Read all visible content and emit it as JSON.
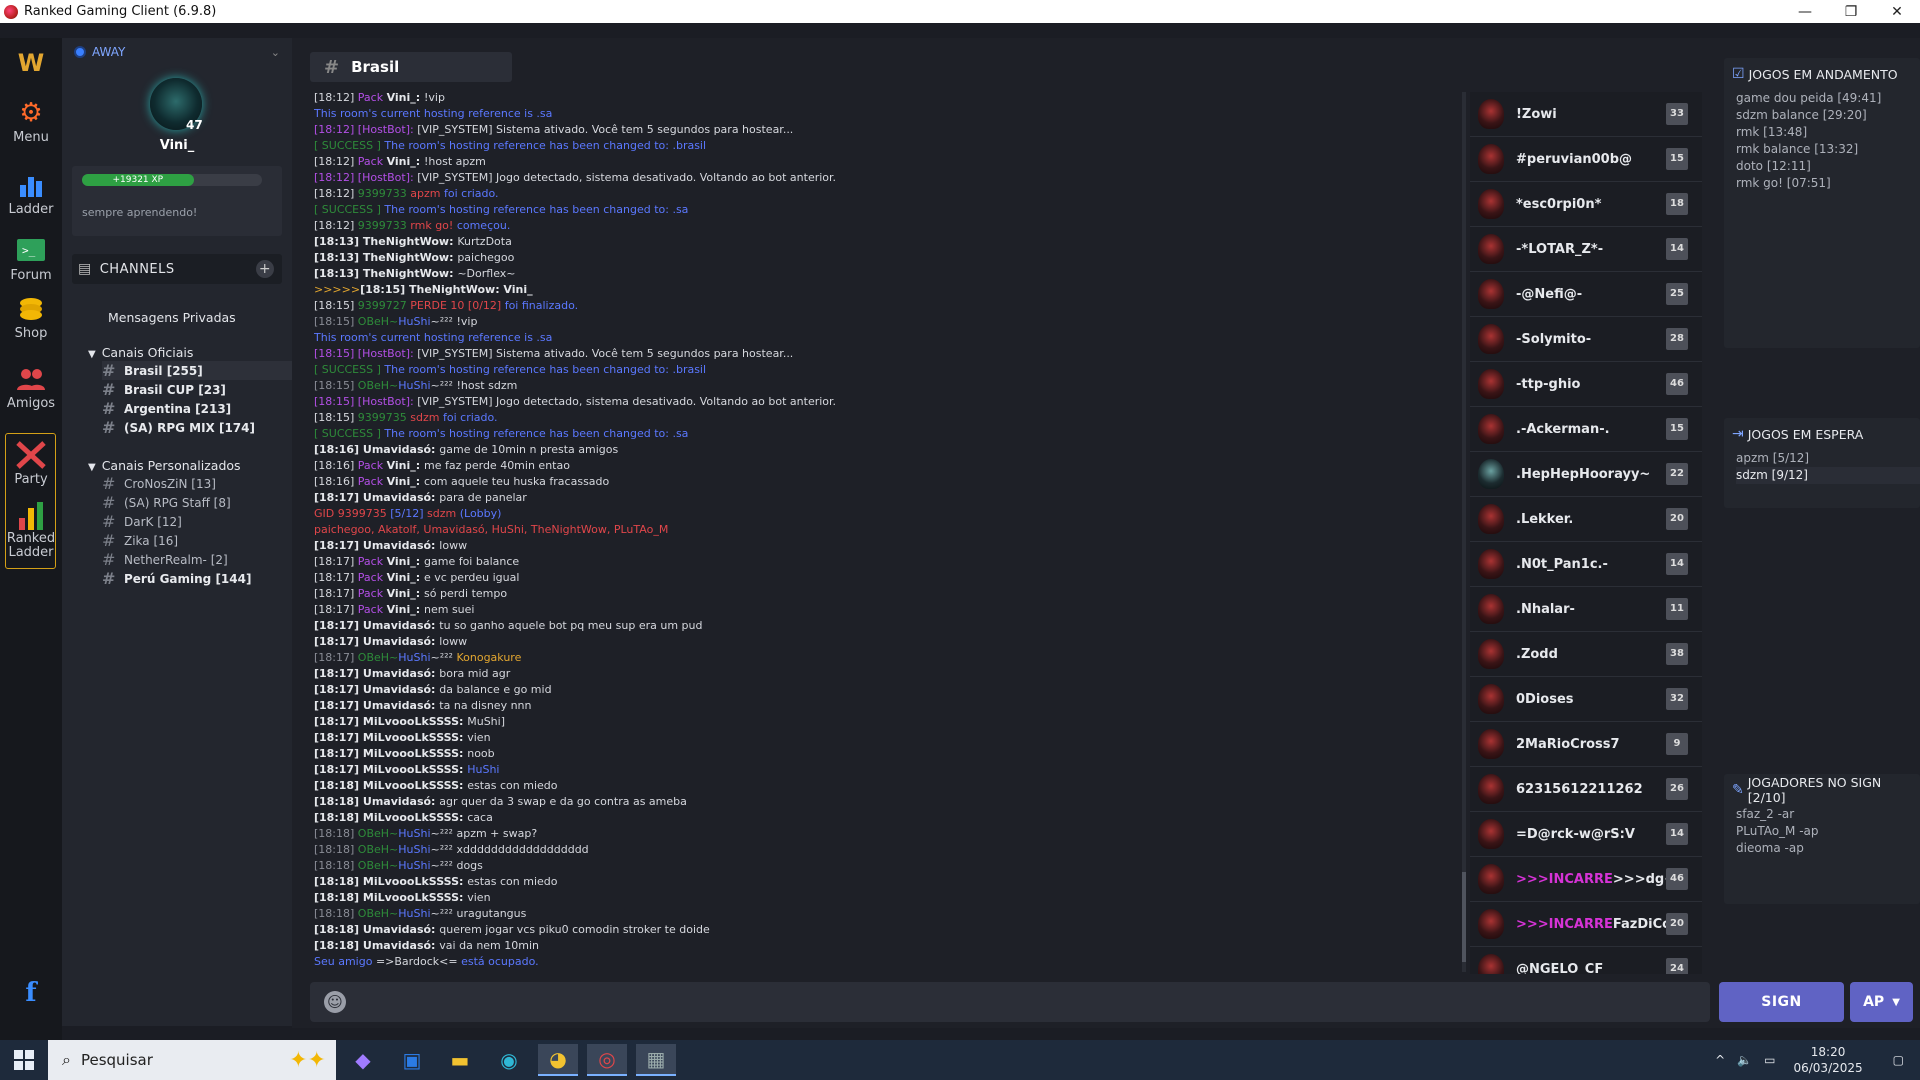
{
  "window": {
    "title": "Ranked Gaming Client (6.9.8)",
    "minimize": "—",
    "maximize": "❐",
    "close": "✕"
  },
  "rail": {
    "menu": "Menu",
    "ladder": "Ladder",
    "forum": "Forum",
    "shop": "Shop",
    "amigos": "Amigos",
    "party": "Party",
    "ranked_ladder_1": "Ranked",
    "ranked_ladder_2": "Ladder",
    "facebook": "f"
  },
  "profile": {
    "status": "AWAY",
    "level": "47",
    "name": "Vini_",
    "xp": "+19321 XP",
    "xp_progress": 0.62,
    "motto": "sempre aprendendo!"
  },
  "channels": {
    "title": "CHANNELS",
    "dm": "Mensagens Privadas",
    "official_title": "Canais Oficiais",
    "official": [
      "Brasil [255]",
      "Brasil CUP [23]",
      "Argentina [213]",
      "(SA) RPG MIX [174]"
    ],
    "custom_title": "Canais Personalizados",
    "custom": [
      "CroNosZiN [13]",
      "(SA) RPG Staff [8]",
      "DarK [12]",
      "Zika [16]",
      "NetherRealm- [2]",
      "Perú Gaming [144]"
    ]
  },
  "chat": {
    "channel": "Brasil",
    "lines": [
      [
        [
          "t",
          "[18:12] "
        ],
        [
          "purp",
          "Pack "
        ],
        [
          "bold",
          "Vini_: "
        ],
        [
          "t",
          "!vip"
        ]
      ],
      [
        [
          "sys",
          "This room's current hosting reference is .sa"
        ]
      ],
      [
        [
          "purp",
          "[18:12] [HostBot]: "
        ],
        [
          "t",
          "[VIP_SYSTEM] Sistema ativado. Você tem 5 segundos para hostear..."
        ]
      ],
      [
        [
          "grn",
          "[ SUCCESS ] "
        ],
        [
          "sys",
          "The room's hosting reference has been changed to: .brasil"
        ]
      ],
      [
        [
          "t",
          "[18:12] "
        ],
        [
          "purp",
          "Pack "
        ],
        [
          "bold",
          "Vini_: "
        ],
        [
          "t",
          "!host apzm"
        ]
      ],
      [
        [
          "purp",
          "[18:12] [HostBot]: "
        ],
        [
          "t",
          "[VIP_SYSTEM] Jogo detectado, sistema desativado. Voltando ao bot anterior."
        ]
      ],
      [
        [
          "t",
          "[18:12] "
        ],
        [
          "grn",
          "9399733 "
        ],
        [
          "red",
          "apzm "
        ],
        [
          "sys",
          "foi criado."
        ]
      ],
      [
        [
          "grn",
          "[ SUCCESS ] "
        ],
        [
          "sys",
          "The room's hosting reference has been changed to: .sa"
        ]
      ],
      [
        [
          "t",
          "[18:12] "
        ],
        [
          "grn",
          "9399733 "
        ],
        [
          "red",
          "rmk go! "
        ],
        [
          "sys",
          "começou."
        ]
      ],
      [
        [
          "bold",
          "[18:13] TheNightWow: "
        ],
        [
          "t",
          "KurtzDota"
        ]
      ],
      [
        [
          "bold",
          "[18:13] TheNightWow: "
        ],
        [
          "t",
          "paichegoo"
        ]
      ],
      [
        [
          "bold",
          "[18:13] TheNightWow: "
        ],
        [
          "t",
          "~Dorflex~"
        ]
      ],
      [
        [
          "gold",
          ">>>>>"
        ],
        [
          "bold",
          "[18:15] TheNightWow: Vini_"
        ]
      ],
      [
        [
          "t",
          "[18:15] "
        ],
        [
          "grn",
          "9399727 "
        ],
        [
          "red",
          "PERDE 10 [0/12] "
        ],
        [
          "sys",
          "foi finalizado."
        ]
      ],
      [
        [
          "tg",
          "[18:15] "
        ],
        [
          "grn",
          "OBeH~"
        ],
        [
          "sys",
          "HuShi"
        ],
        [
          "t",
          "~²²² "
        ],
        [
          "t",
          "!vip"
        ]
      ],
      [
        [
          "sys",
          "This room's current hosting reference is .sa"
        ]
      ],
      [
        [
          "purp",
          "[18:15] [HostBot]: "
        ],
        [
          "t",
          "[VIP_SYSTEM] Sistema ativado. Você tem 5 segundos para hostear..."
        ]
      ],
      [
        [
          "grn",
          "[ SUCCESS ] "
        ],
        [
          "sys",
          "The room's hosting reference has been changed to: .brasil"
        ]
      ],
      [
        [
          "tg",
          "[18:15] "
        ],
        [
          "grn",
          "OBeH~"
        ],
        [
          "sys",
          "HuShi"
        ],
        [
          "t",
          "~²²² "
        ],
        [
          "t",
          "!host sdzm"
        ]
      ],
      [
        [
          "purp",
          "[18:15] [HostBot]: "
        ],
        [
          "t",
          "[VIP_SYSTEM] Jogo detectado, sistema desativado. Voltando ao bot anterior."
        ]
      ],
      [
        [
          "t",
          "[18:15] "
        ],
        [
          "grn",
          "9399735 "
        ],
        [
          "red",
          "sdzm "
        ],
        [
          "sys",
          "foi criado."
        ]
      ],
      [
        [
          "grn",
          "[ SUCCESS ] "
        ],
        [
          "sys",
          "The room's hosting reference has been changed to: .sa"
        ]
      ],
      [
        [
          "bold",
          "[18:16] Umavidasó: "
        ],
        [
          "t",
          "game de 10min n presta amigos"
        ]
      ],
      [
        [
          "t",
          "[18:16] "
        ],
        [
          "purp",
          "Pack "
        ],
        [
          "bold",
          "Vini_: "
        ],
        [
          "t",
          "me faz perde 40min entao"
        ]
      ],
      [
        [
          "t",
          "[18:16] "
        ],
        [
          "purp",
          "Pack "
        ],
        [
          "bold",
          "Vini_: "
        ],
        [
          "t",
          "com aquele teu huska fracassado"
        ]
      ],
      [
        [
          "bold",
          "[18:17] Umavidasó: "
        ],
        [
          "t",
          "para de panelar"
        ]
      ],
      [
        [
          "red",
          "GID 9399735 "
        ],
        [
          "sys",
          "[5/12] "
        ],
        [
          "red",
          "sdzm "
        ],
        [
          "sys",
          "(Lobby)"
        ]
      ],
      [
        [
          "red",
          "paichegoo, Akatolf, Umavidasó, HuShi, TheNightWow, PLuTAo_M"
        ]
      ],
      [
        [
          "bold",
          "[18:17] Umavidasó: "
        ],
        [
          "t",
          "loww"
        ]
      ],
      [
        [
          "t",
          "[18:17] "
        ],
        [
          "purp",
          "Pack "
        ],
        [
          "bold",
          "Vini_: "
        ],
        [
          "t",
          "game foi balance"
        ]
      ],
      [
        [
          "t",
          "[18:17] "
        ],
        [
          "purp",
          "Pack "
        ],
        [
          "bold",
          "Vini_: "
        ],
        [
          "t",
          "e vc perdeu igual"
        ]
      ],
      [
        [
          "t",
          "[18:17] "
        ],
        [
          "purp",
          "Pack "
        ],
        [
          "bold",
          "Vini_: "
        ],
        [
          "t",
          "só perdi tempo"
        ]
      ],
      [
        [
          "t",
          "[18:17] "
        ],
        [
          "purp",
          "Pack "
        ],
        [
          "bold",
          "Vini_: "
        ],
        [
          "t",
          "nem suei"
        ]
      ],
      [
        [
          "bold",
          "[18:17] Umavidasó: "
        ],
        [
          "t",
          "tu so ganho aquele bot pq meu sup era um pud"
        ]
      ],
      [
        [
          "bold",
          "[18:17] Umavidasó: "
        ],
        [
          "t",
          "loww"
        ]
      ],
      [
        [
          "tg",
          "[18:17] "
        ],
        [
          "grn",
          "OBeH~"
        ],
        [
          "sys",
          "HuShi"
        ],
        [
          "t",
          "~²²² "
        ],
        [
          "gold",
          "Konogakure"
        ]
      ],
      [
        [
          "bold",
          "[18:17] Umavidasó: "
        ],
        [
          "t",
          "bora mid agr"
        ]
      ],
      [
        [
          "bold",
          "[18:17] Umavidasó: "
        ],
        [
          "t",
          "da balance e go mid"
        ]
      ],
      [
        [
          "bold",
          "[18:17] Umavidasó: "
        ],
        [
          "t",
          "ta na disney nnn"
        ]
      ],
      [
        [
          "bold",
          "[18:17] MiLvoooLkSSSS: "
        ],
        [
          "t",
          "MuShi]"
        ]
      ],
      [
        [
          "bold",
          "[18:17] MiLvoooLkSSSS: "
        ],
        [
          "t",
          "vien"
        ]
      ],
      [
        [
          "bold",
          "[18:17] MiLvoooLkSSSS: "
        ],
        [
          "t",
          "noob"
        ]
      ],
      [
        [
          "bold",
          "[18:17] MiLvoooLkSSSS: "
        ],
        [
          "sys",
          "HuShi"
        ]
      ],
      [
        [
          "bold",
          "[18:18] MiLvoooLkSSSS: "
        ],
        [
          "t",
          "estas con miedo"
        ]
      ],
      [
        [
          "bold",
          "[18:18] Umavidasó: "
        ],
        [
          "t",
          "agr quer da 3 swap e da go contra as ameba"
        ]
      ],
      [
        [
          "bold",
          "[18:18] MiLvoooLkSSSS: "
        ],
        [
          "t",
          "caca"
        ]
      ],
      [
        [
          "tg",
          "[18:18] "
        ],
        [
          "grn",
          "OBeH~"
        ],
        [
          "sys",
          "HuShi"
        ],
        [
          "t",
          "~²²² "
        ],
        [
          "t",
          "apzm + swap?"
        ]
      ],
      [
        [
          "tg",
          "[18:18] "
        ],
        [
          "grn",
          "OBeH~"
        ],
        [
          "sys",
          "HuShi"
        ],
        [
          "t",
          "~²²² "
        ],
        [
          "t",
          "xdddddddddddddddddd"
        ]
      ],
      [
        [
          "tg",
          "[18:18] "
        ],
        [
          "grn",
          "OBeH~"
        ],
        [
          "sys",
          "HuShi"
        ],
        [
          "t",
          "~²²² "
        ],
        [
          "t",
          "dogs"
        ]
      ],
      [
        [
          "bold",
          "[18:18] MiLvoooLkSSSS: "
        ],
        [
          "t",
          "estas con miedo"
        ]
      ],
      [
        [
          "bold",
          "[18:18] MiLvoooLkSSSS: "
        ],
        [
          "t",
          "vien"
        ]
      ],
      [
        [
          "tg",
          "[18:18] "
        ],
        [
          "grn",
          "OBeH~"
        ],
        [
          "sys",
          "HuShi"
        ],
        [
          "t",
          "~²²² "
        ],
        [
          "t",
          "uragutangus"
        ]
      ],
      [
        [
          "bold",
          "[18:18] Umavidasó: "
        ],
        [
          "t",
          "querem jogar vcs piku0 comodin stroker te doide"
        ]
      ],
      [
        [
          "bold",
          "[18:18] Umavidasó: "
        ],
        [
          "t",
          "vai da nem 10min"
        ]
      ],
      [
        [
          "sys",
          "Seu amigo "
        ],
        [
          "t",
          "=>Bardock<= "
        ],
        [
          "sys",
          "está ocupado."
        ]
      ]
    ]
  },
  "players": [
    {
      "name": "!Zowi",
      "level": "33"
    },
    {
      "name": "#peruvian00b@",
      "level": "15"
    },
    {
      "name": "*esc0rpi0n*",
      "level": "18"
    },
    {
      "name": "-*LOTAR_Z*-",
      "level": "14"
    },
    {
      "name": "-@Nefi@-",
      "level": "25"
    },
    {
      "name": "-Solymito-",
      "level": "28"
    },
    {
      "name": "-ttp-ghio",
      "level": "46"
    },
    {
      "name": ".-Ackerman-.",
      "level": "15"
    },
    {
      "name": ".HepHepHoorayy~",
      "level": "22"
    },
    {
      "name": ".Lekker.",
      "level": "20"
    },
    {
      "name": ".N0t_Pan1c.-",
      "level": "14"
    },
    {
      "name": ".Nhalar-",
      "level": "11"
    },
    {
      "name": ".Zodd",
      "level": "38"
    },
    {
      "name": "0Dioses",
      "level": "32"
    },
    {
      "name": "2MaRioCross7",
      "level": "9"
    },
    {
      "name": "62315612211262",
      "level": "26"
    },
    {
      "name": "=D@rck-w@rS:V",
      "level": "14"
    },
    {
      "name": ">>>INCARRE>>>dg<",
      "level": "46"
    },
    {
      "name": ">>>INCARREFazDiCo",
      "level": "20"
    },
    {
      "name": "@NGELO_CF",
      "level": "24"
    }
  ],
  "games_running": {
    "title": "JOGOS EM ANDAMENTO",
    "items": [
      "game dou peida [49:41]",
      "sdzm balance [29:20]",
      "rmk [13:48]",
      "rmk balance [13:32]",
      "doto [12:11]",
      "rmk go! [07:51]"
    ]
  },
  "games_waiting": {
    "title": "JOGOS EM ESPERA",
    "items": [
      "apzm [5/12]",
      "sdzm [9/12]"
    ]
  },
  "no_sign": {
    "title": "JOGADORES NO SIGN [2/10]",
    "items": [
      "sfaz_2 -ar",
      "PLuTAo_M -ap",
      "dieoma -ap"
    ]
  },
  "actions": {
    "sign": "SIGN",
    "ap": "AP"
  },
  "taskbar": {
    "search": "Pesquisar",
    "time": "18:20",
    "date": "06/03/2025"
  },
  "colors": {
    "accent": "#6063c4",
    "sidebar": "#23262e",
    "background": "#1e2027",
    "highlight": "#d633d6"
  }
}
